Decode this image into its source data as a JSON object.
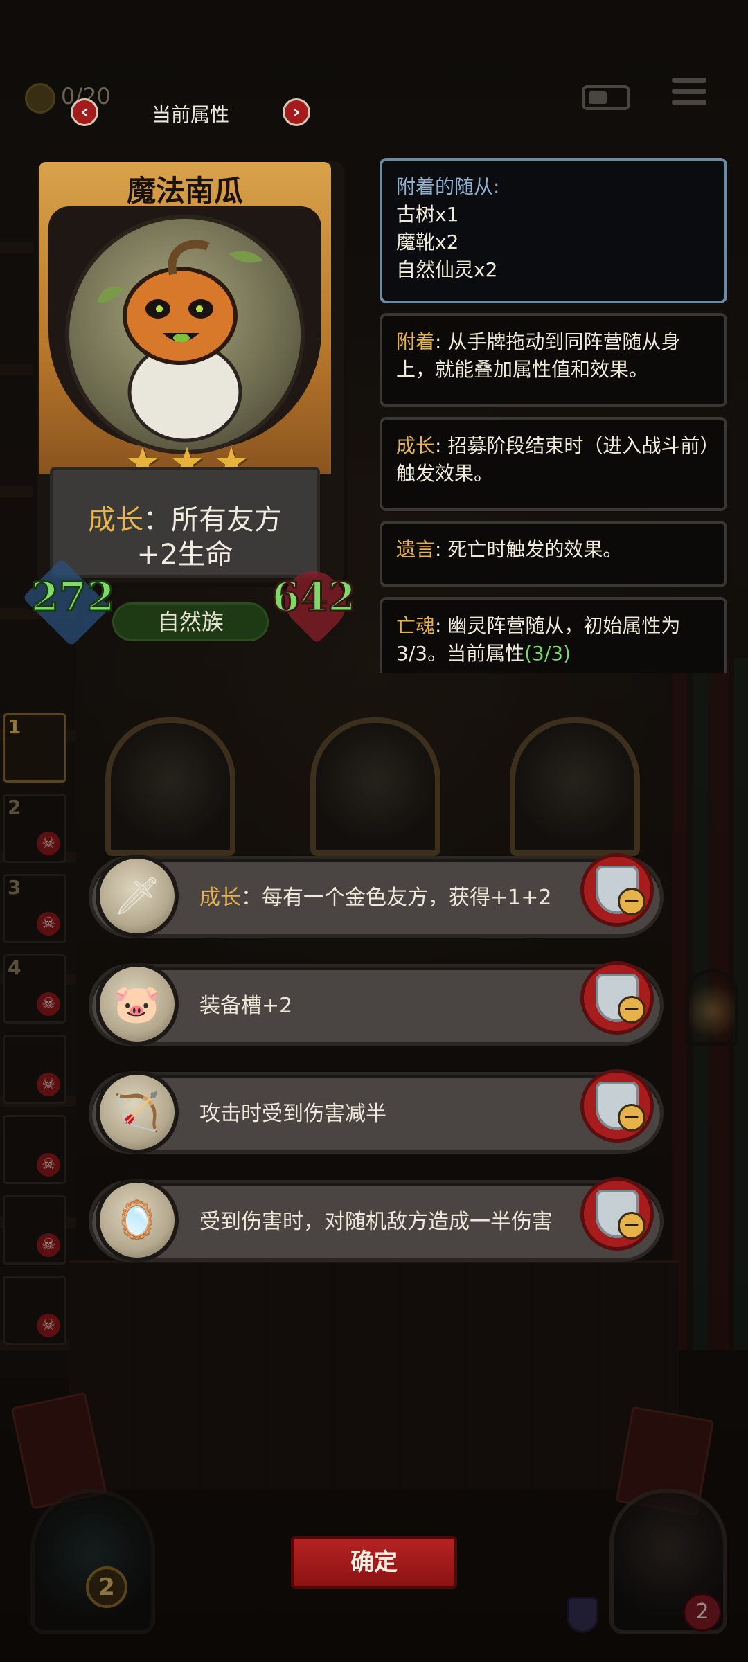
{
  "hud": {
    "coin_text": "0/20"
  },
  "viewer": {
    "title": "当前属性",
    "prev_symbol": "‹",
    "next_symbol": "›"
  },
  "card": {
    "name": "魔法南瓜",
    "stars": 3,
    "star_glyph": "★",
    "desc_keyword": "成长",
    "desc_rest": "：所有友方",
    "desc_line2": "+2生命",
    "attack": "272",
    "health": "642",
    "tribe": "自然族"
  },
  "info": {
    "attached_title": "附着的随从:",
    "attached_items": [
      "古树x1",
      "魔靴x2",
      "自然仙灵x2"
    ],
    "attach_keyword": "附着",
    "attach_text": ": 从手牌拖动到同阵营随从身上，就能叠加属性值和效果。",
    "grow_keyword": "成长",
    "grow_text": ": 招募阶段结束时（进入战斗前）触发效果。",
    "legacy_keyword": "遗言",
    "legacy_text": ": 死亡时触发的效果。",
    "soul_keyword": "亡魂",
    "soul_text": ": 幽灵阵营随从，初始属性为3/3。当前属性",
    "soul_current": "(3/3)"
  },
  "party": {
    "slots": [
      "1",
      "2",
      "3",
      "4",
      "",
      "",
      "",
      ""
    ],
    "skull_glyph": "☠"
  },
  "effects": [
    {
      "icon": "🗡",
      "icon_name": "dagger-icon",
      "keyword": "成长",
      "text": "：每有一个金色友方，获得+1+2"
    },
    {
      "icon": "🐷",
      "icon_name": "pig-icon",
      "keyword": "",
      "text": "装备槽+2"
    },
    {
      "icon": "🏹",
      "icon_name": "crossbow-icon",
      "keyword": "",
      "text": "攻击时受到伤害减半"
    },
    {
      "icon": "🪞",
      "icon_name": "mirror-icon",
      "keyword": "",
      "text": "受到伤害时，对随机敌方造成一半伤害"
    }
  ],
  "remove_symbol": "−",
  "bottom": {
    "confirm_label": "确定",
    "hero_left_badge": "2",
    "hero_right_hp": "2"
  }
}
